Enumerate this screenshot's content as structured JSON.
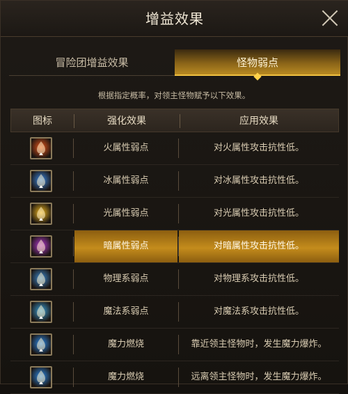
{
  "window": {
    "title": "增益效果"
  },
  "tabs": [
    {
      "label": "冒险团增益效果",
      "active": false
    },
    {
      "label": "怪物弱点",
      "active": true
    }
  ],
  "description": "根据指定概率，对领主怪物赋予以下效果。",
  "table": {
    "headers": [
      "图标",
      "强化效果",
      "应用效果"
    ],
    "rows": [
      {
        "icon": "fire-weakness-icon",
        "effect": "火属性弱点",
        "apply": "对火属性攻击抗性低。",
        "color": "#e8561c"
      },
      {
        "icon": "ice-weakness-icon",
        "effect": "冰属性弱点",
        "apply": "对冰属性攻击抗性低。",
        "color": "#3a86e0"
      },
      {
        "icon": "light-weakness-icon",
        "effect": "光属性弱点",
        "apply": "对光属性攻击抗性低。",
        "color": "#f0b820"
      },
      {
        "icon": "dark-weakness-icon",
        "effect": "暗属性弱点",
        "apply": "对暗属性攻击抗性低。",
        "color": "#b33ad0",
        "highlighted": true
      },
      {
        "icon": "physical-weakness-icon",
        "effect": "物理系弱点",
        "apply": "对物理系攻击抗性低。",
        "color": "#3c8ad0"
      },
      {
        "icon": "magic-weakness-icon",
        "effect": "魔法系弱点",
        "apply": "对魔法系攻击抗性低。",
        "color": "#3aa0d8"
      },
      {
        "icon": "mana-burn-approach-icon",
        "effect": "魔力燃烧",
        "apply": "靠近领主怪物时，发生魔力爆炸。",
        "color": "#2c8ae8"
      },
      {
        "icon": "mana-burn-distance-icon",
        "effect": "魔力燃烧",
        "apply": "远离领主怪物时，发生魔力爆炸。",
        "color": "#2c8ae8"
      }
    ]
  }
}
